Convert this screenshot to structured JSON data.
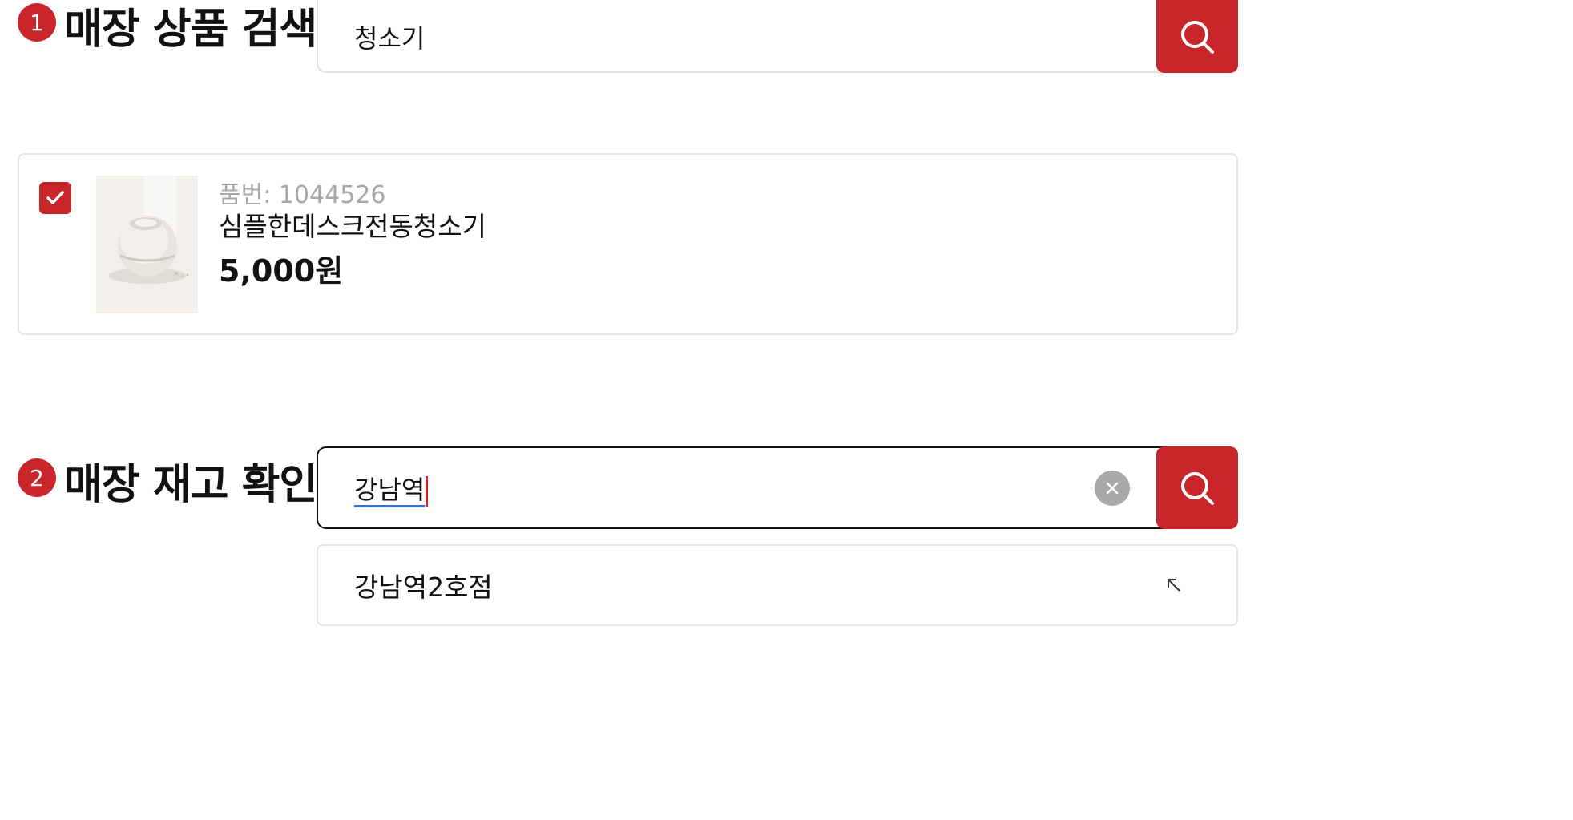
{
  "section1": {
    "badge": "1",
    "title": "매장 상품 검색",
    "search": {
      "value": "청소기"
    },
    "search_icon": "search-icon",
    "product": {
      "checked": true,
      "sku": "품번: 1044526",
      "name": "심플한데스크전동청소기",
      "price": "5,000원"
    }
  },
  "section2": {
    "badge": "2",
    "title": "매장 재고 확인",
    "search": {
      "value": "강남역"
    },
    "clear_icon": "clear-icon",
    "search_icon": "search-icon",
    "suggestions": [
      {
        "label": "강남역2호점",
        "icon": "arrow-up-left-icon"
      }
    ]
  },
  "colors": {
    "accent": "#c8262b",
    "border": "#e2e2e2",
    "active_border": "#111111",
    "muted_text": "#a8a8a8"
  }
}
